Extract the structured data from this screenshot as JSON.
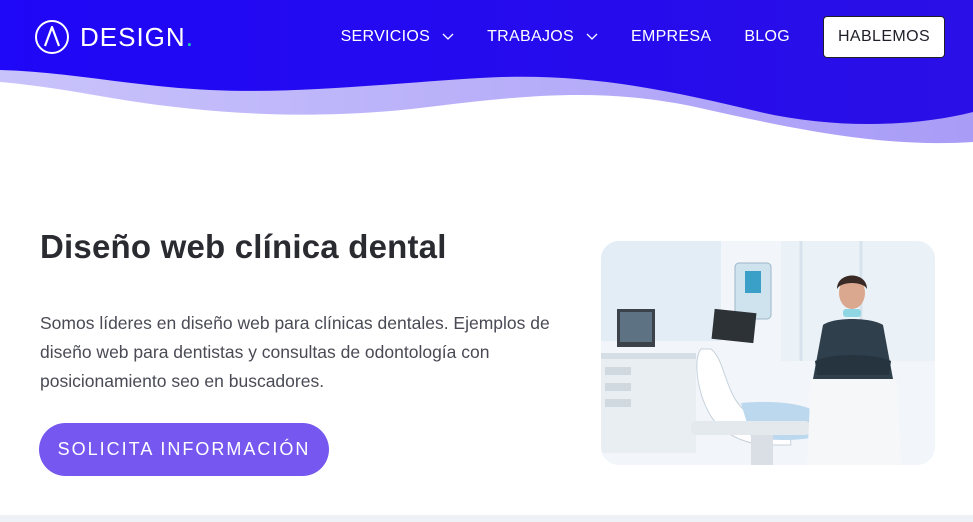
{
  "header": {
    "logo_text": "DESIGN",
    "logo_dot": ".",
    "nav": [
      {
        "label": "SERVICIOS",
        "has_dropdown": true
      },
      {
        "label": "TRABAJOS",
        "has_dropdown": true
      },
      {
        "label": "EMPRESA",
        "has_dropdown": false
      },
      {
        "label": "BLOG",
        "has_dropdown": false
      }
    ],
    "cta_label": "HABLEMOS"
  },
  "hero": {
    "title": "Diseño web clínica dental",
    "description": "Somos líderes en diseño web para clínicas dentales. Ejemplos de diseño web para dentistas y consultas de odontología con posicionamiento seo en buscadores.",
    "cta_label": "SOLICITA INFORMACIÓN"
  },
  "colors": {
    "header_primary": "#1a00f5",
    "header_wave_light": "#bcb4fb",
    "accent_button": "#7657f0",
    "logo_dot": "#18d6b3"
  },
  "icons": [
    "logo-mark-icon",
    "chevron-down-icon"
  ]
}
